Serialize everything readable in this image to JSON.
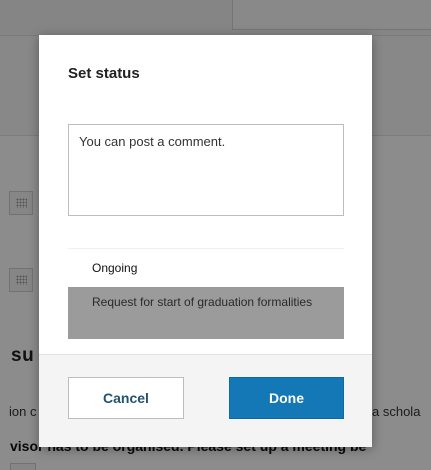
{
  "background_page": {
    "heading_fragment": "su",
    "text_left_fragment": "ion c",
    "text_right_fragment": "a schola",
    "sentence_fragment": "visor has to be organised. Please set up a meeting be"
  },
  "dialog": {
    "title": "Set status",
    "comment": {
      "placeholder": "You can post a comment.",
      "value": ""
    },
    "status_options": [
      {
        "label": "Ongoing",
        "selected": false
      },
      {
        "label": "Request for start of graduation formalities",
        "selected": true
      }
    ],
    "buttons": {
      "cancel_label": "Cancel",
      "done_label": "Done"
    }
  },
  "colors": {
    "primary_button": "#1477b6",
    "selected_option": "#9b9b9b",
    "overlay": "rgba(0,0,0,0.45)"
  },
  "icons": {
    "date_field_icon": "calendar-icon"
  }
}
